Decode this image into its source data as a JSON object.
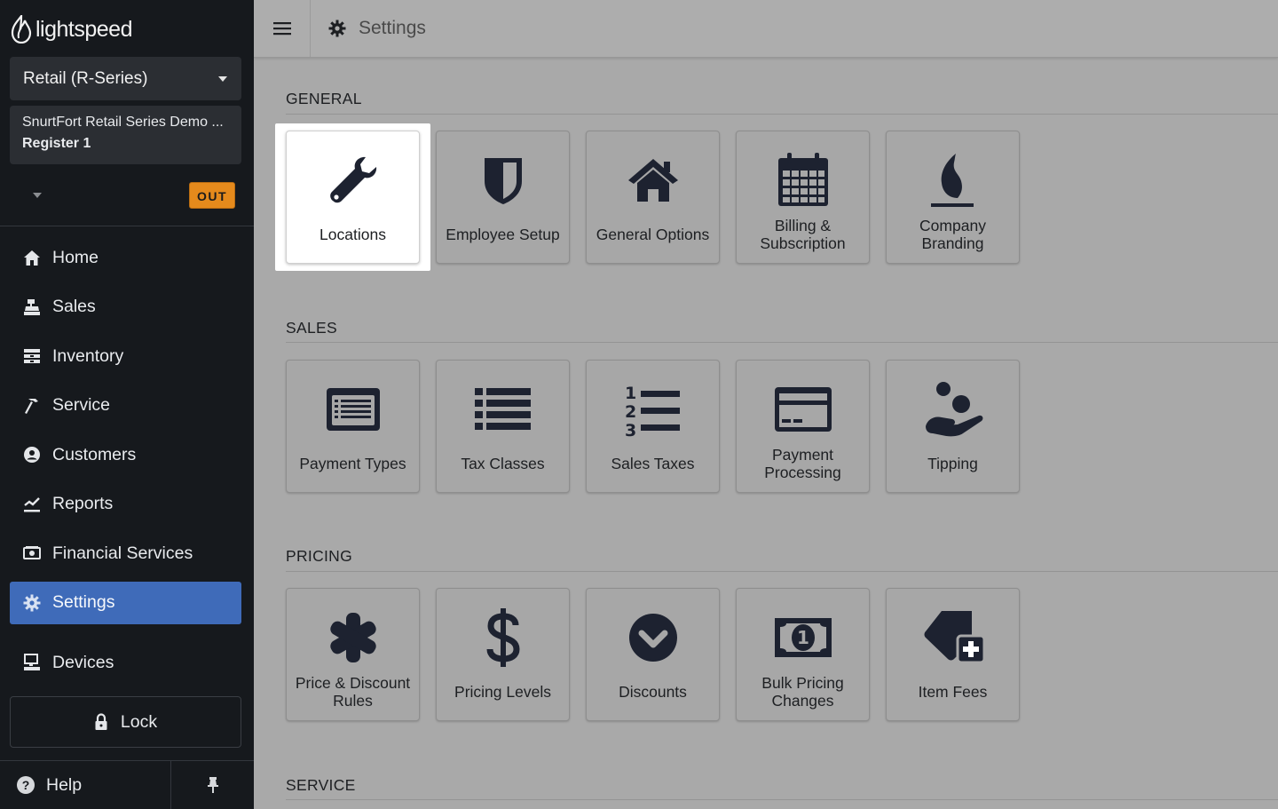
{
  "brand": {
    "logo_text": "lightspeed"
  },
  "sidebar": {
    "app_selector": "Retail (R-Series)",
    "shop_name": "SnurtFort Retail Series Demo ...",
    "register": "Register 1",
    "status_badge": "OUT",
    "nav": [
      {
        "label": "Home",
        "icon": "home-icon"
      },
      {
        "label": "Sales",
        "icon": "cash-register-icon"
      },
      {
        "label": "Inventory",
        "icon": "inventory-icon"
      },
      {
        "label": "Service",
        "icon": "hammer-icon"
      },
      {
        "label": "Customers",
        "icon": "user-circle-icon"
      },
      {
        "label": "Reports",
        "icon": "chart-icon"
      },
      {
        "label": "Financial Services",
        "icon": "money-icon"
      },
      {
        "label": "Settings",
        "icon": "gear-icon",
        "active": true
      }
    ],
    "devices": "Devices",
    "lock": "Lock",
    "help": "Help"
  },
  "topbar": {
    "title": "Settings"
  },
  "sections": [
    {
      "title": "GENERAL",
      "tiles": [
        {
          "label": "Locations",
          "icon": "wrench-icon",
          "highlighted": true
        },
        {
          "label": "Employee Setup",
          "icon": "shield-icon"
        },
        {
          "label": "General Options",
          "icon": "house-icon"
        },
        {
          "label": "Billing & Subscription",
          "icon": "calendar-icon"
        },
        {
          "label": "Company Branding",
          "icon": "flame-icon"
        }
      ]
    },
    {
      "title": "SALES",
      "tiles": [
        {
          "label": "Payment Types",
          "icon": "payment-list-icon"
        },
        {
          "label": "Tax Classes",
          "icon": "list-icon"
        },
        {
          "label": "Sales Taxes",
          "icon": "numbered-list-icon"
        },
        {
          "label": "Payment Processing",
          "icon": "credit-card-icon"
        },
        {
          "label": "Tipping",
          "icon": "hand-coins-icon"
        }
      ]
    },
    {
      "title": "PRICING",
      "tiles": [
        {
          "label": "Price & Discount Rules",
          "icon": "asterisk-icon"
        },
        {
          "label": "Pricing Levels",
          "icon": "dollar-icon"
        },
        {
          "label": "Discounts",
          "icon": "chevron-circle-icon"
        },
        {
          "label": "Bulk Pricing Changes",
          "icon": "bill-icon"
        },
        {
          "label": "Item Fees",
          "icon": "tag-plus-icon"
        }
      ]
    },
    {
      "title": "SERVICE",
      "tiles": []
    }
  ]
}
